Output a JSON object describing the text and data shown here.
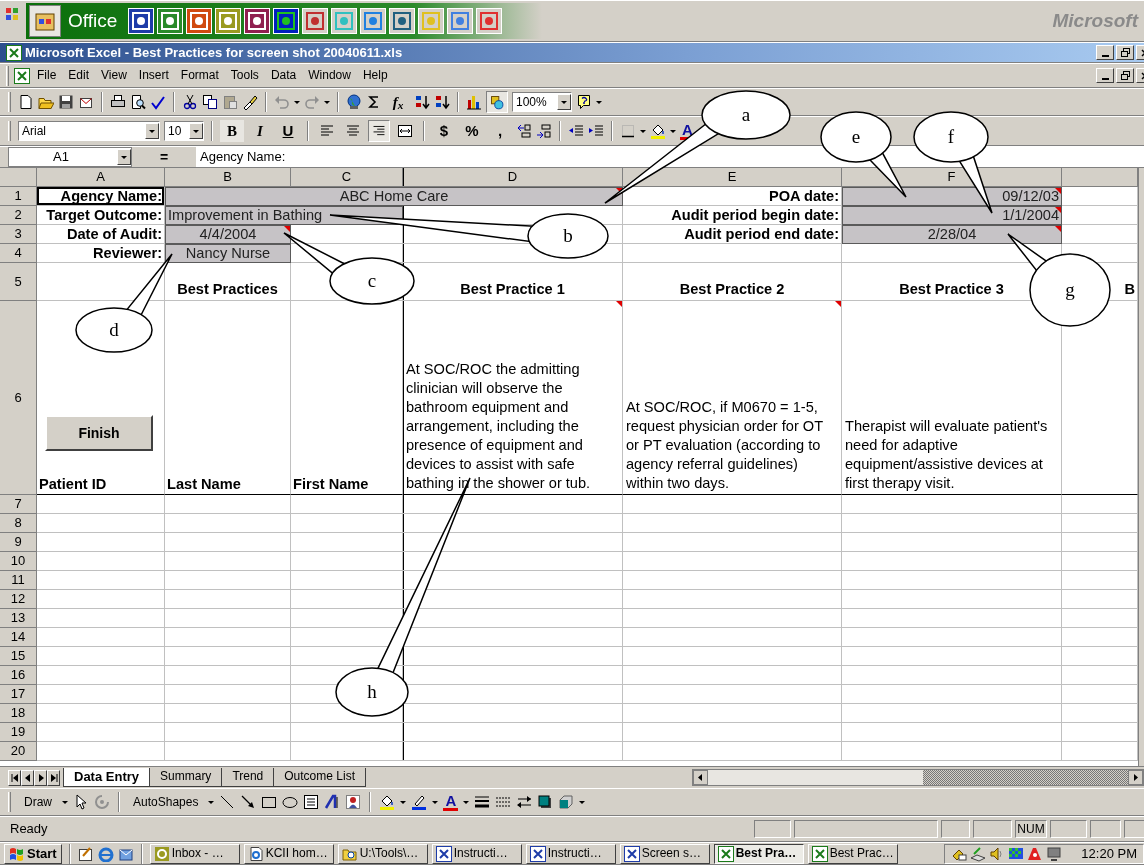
{
  "office_bar": {
    "label": "Office",
    "brand": "Microsoft"
  },
  "window": {
    "title": "Microsoft Excel - Best Practices for screen shot 20040611.xls"
  },
  "menu": [
    "File",
    "Edit",
    "View",
    "Insert",
    "Format",
    "Tools",
    "Data",
    "Window",
    "Help"
  ],
  "standard_toolbar": {
    "function_symbol": "f$_{x}$",
    "zoom": "100%",
    "drawing_toggle": {
      "pressed": true
    }
  },
  "formatting_toolbar": {
    "font": "Arial",
    "size": "10",
    "style_buttons": [
      {
        "label": "B",
        "kind": "bold",
        "pressed": true
      },
      {
        "label": "I",
        "kind": "italic",
        "pressed": false
      },
      {
        "label": "U",
        "kind": "underline",
        "pressed": false
      }
    ],
    "align_buttons": [
      {
        "kind": "left",
        "pressed": false
      },
      {
        "kind": "center",
        "pressed": false
      },
      {
        "kind": "right",
        "pressed": true
      },
      {
        "kind": "merge",
        "pressed": false
      }
    ],
    "number_buttons": [
      "$",
      "%",
      ","
    ],
    "font_color_symbol": "A"
  },
  "formula_bar": {
    "name_box": "A1",
    "equals": "=",
    "content": "Agency Name:"
  },
  "sheet": {
    "columns": [
      "A",
      "B",
      "C",
      "D",
      "E",
      "F"
    ],
    "rows": [
      {
        "header": "1",
        "cells": [
          {
            "kind": "label",
            "text": "Agency Name:",
            "selected": true
          },
          {
            "kind": "input",
            "text": "ABC Home Care",
            "centered": true,
            "comment": true
          },
          {
            "kind": "merged"
          },
          {
            "kind": "merged"
          },
          {
            "kind": "label",
            "text": "POA date:"
          },
          {
            "kind": "input",
            "text": "09/12/03",
            "right_aligned": true,
            "comment": true
          },
          {
            "kind": "blank"
          }
        ]
      },
      {
        "header": "2",
        "cells": [
          {
            "kind": "label",
            "text": "Target Outcome:"
          },
          {
            "kind": "input",
            "text": "Improvement in Bathing"
          },
          {
            "kind": "merged"
          },
          {
            "kind": "blank"
          },
          {
            "kind": "label",
            "text": "Audit period begin date:"
          },
          {
            "kind": "input",
            "text": "1/1/2004",
            "right_aligned": true,
            "comment": true
          },
          {
            "kind": "blank"
          }
        ]
      },
      {
        "header": "3",
        "cells": [
          {
            "kind": "label",
            "text": "Date of Audit:"
          },
          {
            "kind": "input",
            "text": "4/4/2004",
            "centered": true,
            "comment": true
          },
          {
            "kind": "blank"
          },
          {
            "kind": "blank"
          },
          {
            "kind": "label",
            "text": "Audit period end date:"
          },
          {
            "kind": "input",
            "text": "2/28/04",
            "centered": true,
            "comment": true
          },
          {
            "kind": "blank"
          }
        ]
      },
      {
        "header": "4",
        "cells": [
          {
            "kind": "label",
            "text": "Reviewer:"
          },
          {
            "kind": "input",
            "text": "Nancy Nurse",
            "centered": true
          },
          {
            "kind": "blank"
          },
          {
            "kind": "blank"
          },
          {
            "kind": "blank"
          },
          {
            "kind": "blank"
          },
          {
            "kind": "blank"
          }
        ]
      },
      {
        "header": "5",
        "cells": [
          {
            "kind": "blank"
          },
          {
            "kind": "heading",
            "text": "Best Practices"
          },
          {
            "kind": "blank"
          },
          {
            "kind": "heading",
            "text": "Best Practice 1"
          },
          {
            "kind": "heading",
            "text": "Best Practice 2"
          },
          {
            "kind": "heading",
            "text": "Best Practice 3"
          },
          {
            "kind": "heading",
            "text": "B",
            "right_aligned": true
          }
        ]
      },
      {
        "header": "6",
        "cells": [
          {
            "kind": "colhead",
            "text": "Patient ID"
          },
          {
            "kind": "colhead",
            "text": "Last Name"
          },
          {
            "kind": "colhead",
            "text": "First Name"
          },
          {
            "kind": "note",
            "text": "At SOC/ROC the admitting clinician will observe the bathroom equipment and arrangement, including the presence of equipment and devices to assist with safe bathing in the shower or tub.",
            "comment": true
          },
          {
            "kind": "note",
            "text": "At SOC/ROC, if M0670 = 1-5, request physician order for OT or PT evaluation (according to agency referral guidelines) within two days.",
            "comment": true
          },
          {
            "kind": "note",
            "text": "Therapist will evaluate patient's need for adaptive equipment/assistive devices at first therapy visit."
          },
          {
            "kind": "blank"
          }
        ]
      },
      {
        "header": "7"
      },
      {
        "header": "8"
      },
      {
        "header": "9"
      },
      {
        "header": "10"
      },
      {
        "header": "11"
      },
      {
        "header": "12"
      },
      {
        "header": "13"
      },
      {
        "header": "14"
      },
      {
        "header": "15"
      },
      {
        "header": "16"
      },
      {
        "header": "17"
      },
      {
        "header": "18"
      },
      {
        "header": "19"
      },
      {
        "header": "20"
      }
    ],
    "button": {
      "label": "Finish"
    }
  },
  "callouts": [
    {
      "letter": "a"
    },
    {
      "letter": "b"
    },
    {
      "letter": "c"
    },
    {
      "letter": "d"
    },
    {
      "letter": "e"
    },
    {
      "letter": "f"
    },
    {
      "letter": "g"
    },
    {
      "letter": "h"
    }
  ],
  "sheet_tabs": [
    {
      "label": "Data Entry",
      "selected": true
    },
    {
      "label": "Summary",
      "selected": false
    },
    {
      "label": "Trend",
      "selected": false
    },
    {
      "label": "Outcome List",
      "selected": false
    }
  ],
  "drawing_toolbar": {
    "draw": "Draw",
    "autoshapes": "AutoShapes",
    "font_color_symbol": "A"
  },
  "status_bar": {
    "text": "Ready",
    "num": "NUM"
  },
  "taskbar": {
    "start": "Start",
    "tasks": [
      {
        "label": "Inbox - …",
        "selected": false
      },
      {
        "label": "KCII hom…",
        "selected": false
      },
      {
        "label": "U:\\Tools\\…",
        "selected": false
      },
      {
        "label": "Instructi…",
        "selected": false
      },
      {
        "label": "Instructi…",
        "selected": false
      },
      {
        "label": "Screen s…",
        "selected": false
      },
      {
        "label": "Best Pra…",
        "selected": true
      },
      {
        "label": "Best Prac…",
        "selected": false
      }
    ],
    "clock": "12:20 PM"
  }
}
